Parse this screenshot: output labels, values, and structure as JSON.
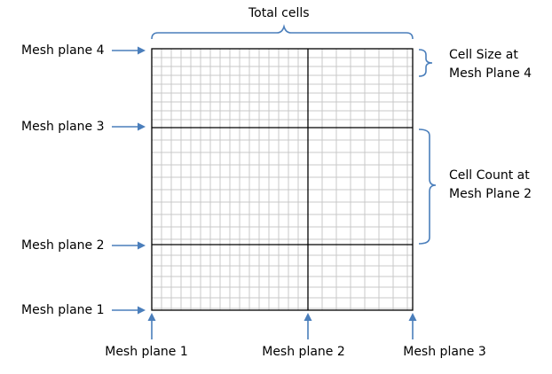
{
  "top_label": "Total cells",
  "left_labels": [
    "Mesh plane 4",
    "Mesh plane 3",
    "Mesh plane 2",
    "Mesh plane 1"
  ],
  "bottom_labels": [
    "Mesh plane 1",
    "Mesh plane 2",
    "Mesh plane 3"
  ],
  "right_labels": {
    "cell_size": [
      "Cell Size at",
      "Mesh Plane 4"
    ],
    "cell_count": [
      "Cell Count at",
      "Mesh Plane 2"
    ]
  },
  "colors": {
    "arrow": "#4a7ebb",
    "grid_fine": "#c8c8c8",
    "grid_major": "#000000"
  }
}
